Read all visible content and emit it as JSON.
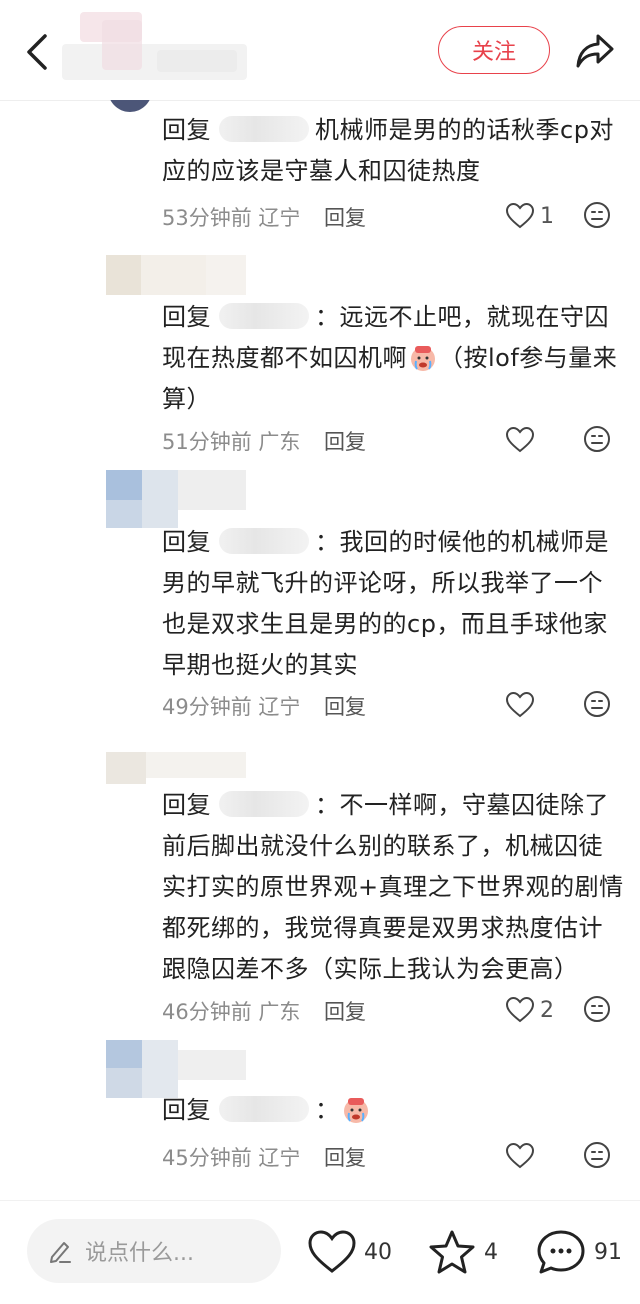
{
  "header": {
    "follow_label": "关注"
  },
  "comments": [
    {
      "reply_prefix": "回复",
      "text": "机械师是男的的话秋季cp对应的应该是守墓人和囚徒热度",
      "time_location": "53分钟前 辽宁",
      "reply_label": "回复",
      "like_count": "1"
    },
    {
      "reply_prefix": "回复",
      "text_before": "：远远不止吧，就现在守囚现在热度都不如囚机啊",
      "text_after": "（按lof参与量来算）",
      "time_location": "51分钟前 广东",
      "reply_label": "回复",
      "like_count": ""
    },
    {
      "reply_prefix": "回复",
      "text": "：我回的时候他的机械师是男的早就飞升的评论呀，所以我举了一个也是双求生且是男的的cp，而且手球他家早期也挺火的其实",
      "time_location": "49分钟前 辽宁",
      "reply_label": "回复",
      "like_count": ""
    },
    {
      "reply_prefix": "回复",
      "text": "：不一样啊，守墓囚徒除了前后脚出就没什么别的联系了，机械囚徒实打实的原世界观+真理之下世界观的剧情都死绑的，我觉得真要是双男求热度估计跟隐囚差不多（实际上我认为会更高）",
      "time_location": "46分钟前 广东",
      "reply_label": "回复",
      "like_count": "2"
    },
    {
      "reply_prefix": "回复",
      "text": "：",
      "time_location": "45分钟前 辽宁",
      "reply_label": "回复",
      "like_count": ""
    }
  ],
  "bottom_bar": {
    "input_placeholder": "说点什么...",
    "like_count": "40",
    "favorite_count": "4",
    "comment_count": "91"
  }
}
